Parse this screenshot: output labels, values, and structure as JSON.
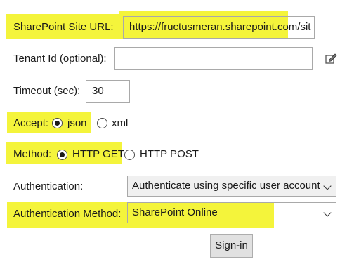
{
  "form": {
    "site_url_label": "SharePoint Site URL:",
    "site_url_value": "https://fructusmeran.sharepoint.com/sit",
    "tenant_label": "Tenant Id (optional):",
    "tenant_value": "",
    "timeout_label": "Timeout (sec):",
    "timeout_value": "30",
    "accept_label": "Accept:",
    "accept_options": [
      "json",
      "xml"
    ],
    "accept_selected": "json",
    "method_label": "Method:",
    "method_options": [
      "HTTP GET",
      "HTTP POST"
    ],
    "method_selected": "HTTP GET",
    "authentication_label": "Authentication:",
    "authentication_value": "Authenticate using specific user account",
    "auth_method_label": "Authentication Method:",
    "auth_method_value": "SharePoint Online",
    "signin_label": "Sign-in"
  },
  "icons": {
    "tenant_edit": "edit-icon"
  },
  "colors": {
    "highlight": "#f4f43b"
  }
}
